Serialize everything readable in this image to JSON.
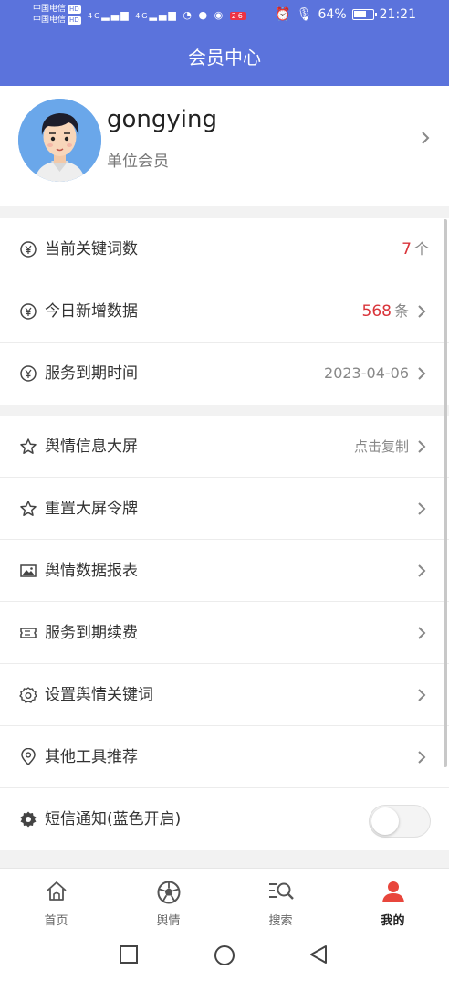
{
  "status_bar": {
    "carrier1": "中国电信",
    "carrier2": "中国电信",
    "hd": "HD",
    "net1": "4G",
    "net2": "4G",
    "badge": "26",
    "battery": "64%",
    "time": "21:21"
  },
  "header": {
    "title": "会员中心"
  },
  "profile": {
    "username": "gongying",
    "member_type": "单位会员"
  },
  "stats": [
    {
      "label": "当前关键词数",
      "value": "7",
      "unit": "个",
      "icon": "yen-circle-icon"
    },
    {
      "label": "今日新增数据",
      "value": "568",
      "unit": "条",
      "icon": "yen-circle-icon"
    },
    {
      "label": "服务到期时间",
      "value": "2023-04-06",
      "icon": "yen-circle-icon"
    }
  ],
  "menu": [
    {
      "label": "舆情信息大屏",
      "right": "点击复制",
      "icon": "star-icon"
    },
    {
      "label": "重置大屏令牌",
      "icon": "star-icon"
    },
    {
      "label": "舆情数据报表",
      "icon": "image-icon"
    },
    {
      "label": "服务到期续费",
      "icon": "ticket-icon"
    },
    {
      "label": "设置舆情关键词",
      "icon": "settings-icon"
    },
    {
      "label": "其他工具推荐",
      "icon": "location-pin-icon"
    },
    {
      "label": "短信通知(蓝色开启)",
      "icon": "gear-icon",
      "toggle": false
    }
  ],
  "tabs": [
    {
      "label": "首页",
      "icon": "home-icon"
    },
    {
      "label": "舆情",
      "icon": "football-icon"
    },
    {
      "label": "搜索",
      "icon": "search-list-icon"
    },
    {
      "label": "我的",
      "icon": "user-icon",
      "active": true
    }
  ],
  "colors": {
    "primary": "#5b73dc",
    "accent_red": "#d9343a",
    "active_tab": "#e8463c"
  }
}
